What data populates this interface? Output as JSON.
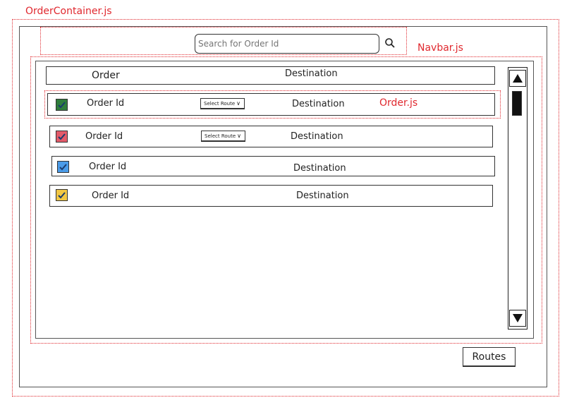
{
  "annotations": {
    "order_container": "OrderContainer.js",
    "navbar": "Navbar.js",
    "order": "Order.js"
  },
  "search": {
    "placeholder": "Search for Order Id",
    "icon": "search-icon"
  },
  "table_header": {
    "order_label": "Order",
    "destination_label": "Destination"
  },
  "orders": [
    {
      "id_label": "Order Id",
      "destination": "Destination",
      "route_select": "Select Route",
      "checkbox_color": "#2f7d3c",
      "show_select": true
    },
    {
      "id_label": "Order Id",
      "destination": "Destination",
      "route_select": "Select Route",
      "checkbox_color": "#e35b6a",
      "show_select": true
    },
    {
      "id_label": "Order Id",
      "destination": "Destination",
      "route_select": "",
      "checkbox_color": "#4a9be8",
      "show_select": false
    },
    {
      "id_label": "Order Id",
      "destination": "Destination",
      "route_select": "",
      "checkbox_color": "#f2c744",
      "show_select": false
    }
  ],
  "footer": {
    "routes_button": "Routes"
  },
  "colors": {
    "annotation": "#e0282e"
  }
}
